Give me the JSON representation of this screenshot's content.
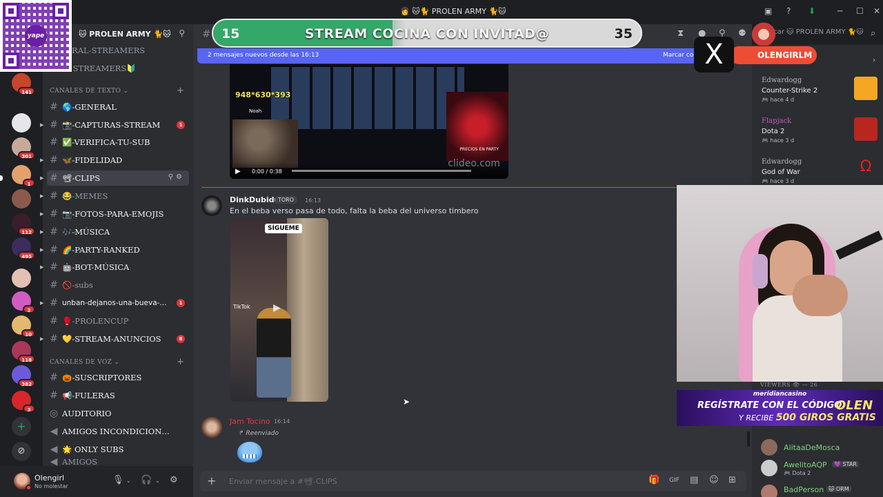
{
  "window": {
    "title": "👩 🐱🐈 PROLEN ARMY 🐈🐱"
  },
  "qr": {
    "logo_text": "yape"
  },
  "server": {
    "name": "🐱 PROLEN ARMY 🐈🐱"
  },
  "rail": {
    "badges": [
      "141",
      "301",
      "1",
      "112",
      "495",
      "2",
      "10",
      "118",
      "382",
      "3"
    ]
  },
  "channels_top": [
    {
      "label": "GENERAL-STREAMERS"
    },
    {
      "label": "ONLY STREAMERS🔰"
    }
  ],
  "categories": {
    "text": "CANALES DE TEXTO ⌄",
    "voice": "CANALES DE VOZ ⌄"
  },
  "text_channels": [
    {
      "label": "🌎-GENERAL",
      "count": ""
    },
    {
      "label": "📸-CAPTURAS-STREAM",
      "count": "1"
    },
    {
      "label": "✅-VERIFICA-TU-SUB",
      "count": ""
    },
    {
      "label": "🦋-FIDELIDAD",
      "count": ""
    },
    {
      "label": "📽-CLIPS",
      "count": ""
    },
    {
      "label": "😂-MEMES",
      "count": ""
    },
    {
      "label": "📷-FOTOS-PARA-EMOJIS",
      "count": ""
    },
    {
      "label": "🎶-MÚSICA",
      "count": ""
    },
    {
      "label": "🌈-PARTY-RANKED",
      "count": ""
    },
    {
      "label": "🤖-BOT-MÚSICA",
      "count": ""
    },
    {
      "label": "🚫-subs",
      "count": ""
    },
    {
      "label": "unban-dejanos-una-bueva-...",
      "count": "1"
    },
    {
      "label": "🥊-PROLENCUP",
      "count": ""
    },
    {
      "label": "💛-STREAM-ANUNCIOS",
      "count": "8"
    }
  ],
  "voice_channels": [
    {
      "label": "🎃-SUSCRIPTORES"
    },
    {
      "label": "📢-FULERAS"
    },
    {
      "label": "AUDITORIO"
    },
    {
      "label": "AMIGOS INCONDICIONALES"
    },
    {
      "label": "🌟 ONLY SUBS"
    },
    {
      "label": "AMIGOS"
    }
  ],
  "user": {
    "name": "Olengirl",
    "status": "No molestar"
  },
  "banner": {
    "left_num": "15",
    "text": "STREAM COCINA CON INVITAD@",
    "right_num": "35"
  },
  "new_messages": {
    "text": "2 mensajes nuevos desde las 16:13",
    "mark": "Marcar co"
  },
  "video1": {
    "price_text": "948*630*393",
    "time": "0:00 / 0:38",
    "watermark": "clideo.com",
    "label_small": "Noah",
    "promo_small": "PRECIOS EN PARTY"
  },
  "messages": [
    {
      "author": "DinkDubidu",
      "tag": "TORO",
      "time": "16:13",
      "text": "En el beba verso pasa de todo, falta la beba del universo timbero",
      "embed_follow": "SÍGUEME",
      "embed_tiktok": "TikTok"
    },
    {
      "author": "Jam Tocino",
      "time": "16:14",
      "forward": "↱ Reenviado"
    }
  ],
  "composer": {
    "placeholder": "Enviar mensaje a #📽-CLIPS"
  },
  "search": {
    "text": "scar 🐱 PROLEN ARMY 🐈🐱"
  },
  "overlay": {
    "x_label": "X",
    "handle": "OLENGIRLM"
  },
  "activity": [
    {
      "user": "Edwardogg",
      "game": "Counter-Strike 2",
      "ago": "🎮 hace 4 d",
      "icon_color": "#f5a623"
    },
    {
      "user": "Flapjack",
      "game": "Dota 2",
      "ago": "🎮 hace 3 d",
      "icon_color": "#b8261f"
    },
    {
      "user": "Edwardogg",
      "game": "God of War",
      "ago": "🎮 hace 3 d",
      "icon_color": "#2b2d31"
    }
  ],
  "viewers": "VIEWERS 👁 — 26",
  "promo": {
    "brand": "meridiancasino",
    "line1": "REGÍSTRATE CON EL CÓDIGO",
    "code": "OLEN",
    "line2_pre": "Y RECIBE ",
    "line2_bold": "500 GIROS GRATIS"
  },
  "members": [
    {
      "name": "AlitaaDeMosca",
      "sub": "",
      "tag": ""
    },
    {
      "name": "AwelitoAQP",
      "sub": "🎮 Dota 2",
      "tag": "💜 STAR"
    },
    {
      "name": "BadPerson",
      "sub": "",
      "tag": "🐱 ORM"
    }
  ],
  "colors": {
    "blurple": "#5865f2",
    "red": "#da373c",
    "green_name": "#7ed47b",
    "sidebar": "#2b2d31",
    "chat": "#313338"
  }
}
